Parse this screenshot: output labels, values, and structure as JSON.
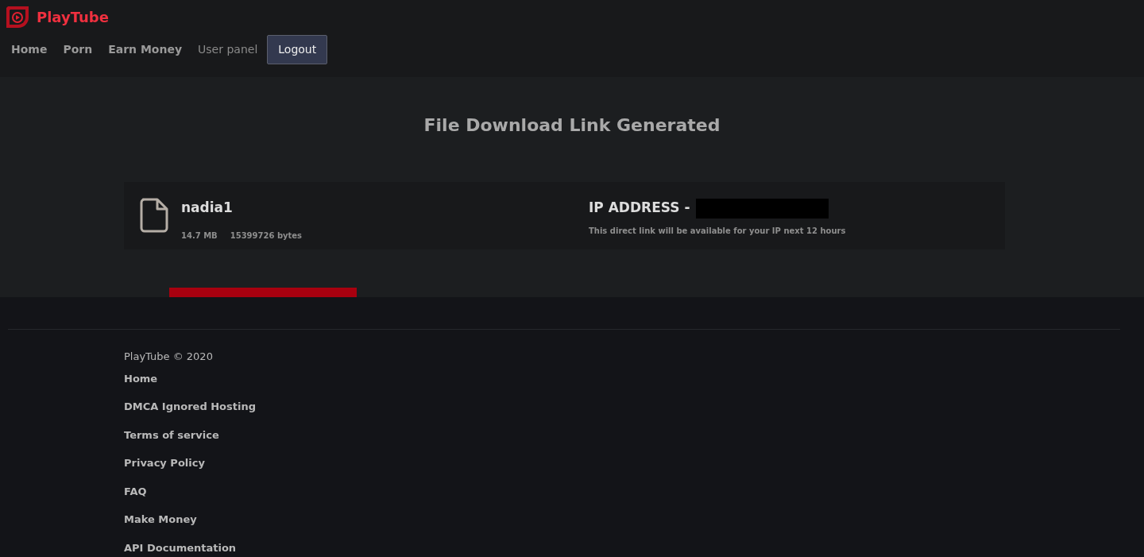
{
  "brand": {
    "name": "PlayTube"
  },
  "nav": [
    {
      "label": "Home",
      "kind": "link"
    },
    {
      "label": "Porn",
      "kind": "link"
    },
    {
      "label": "Earn Money",
      "kind": "link"
    },
    {
      "label": "User panel",
      "kind": "muted"
    },
    {
      "label": "Logout",
      "kind": "button"
    }
  ],
  "heading": "File Download Link Generated",
  "file": {
    "name": "nadia1",
    "size": "14.7 MB",
    "bytes": "15399726 bytes"
  },
  "ip": {
    "label": "IP ADDRESS -",
    "redacted": true,
    "note": "This direct link will be available for your IP next 12 hours"
  },
  "footer": {
    "copyright": "PlayTube © 2020",
    "links": [
      "Home",
      "DMCA Ignored Hosting",
      "Terms of service",
      "Privacy Policy",
      "FAQ",
      "Make Money",
      "API Documentation"
    ]
  }
}
